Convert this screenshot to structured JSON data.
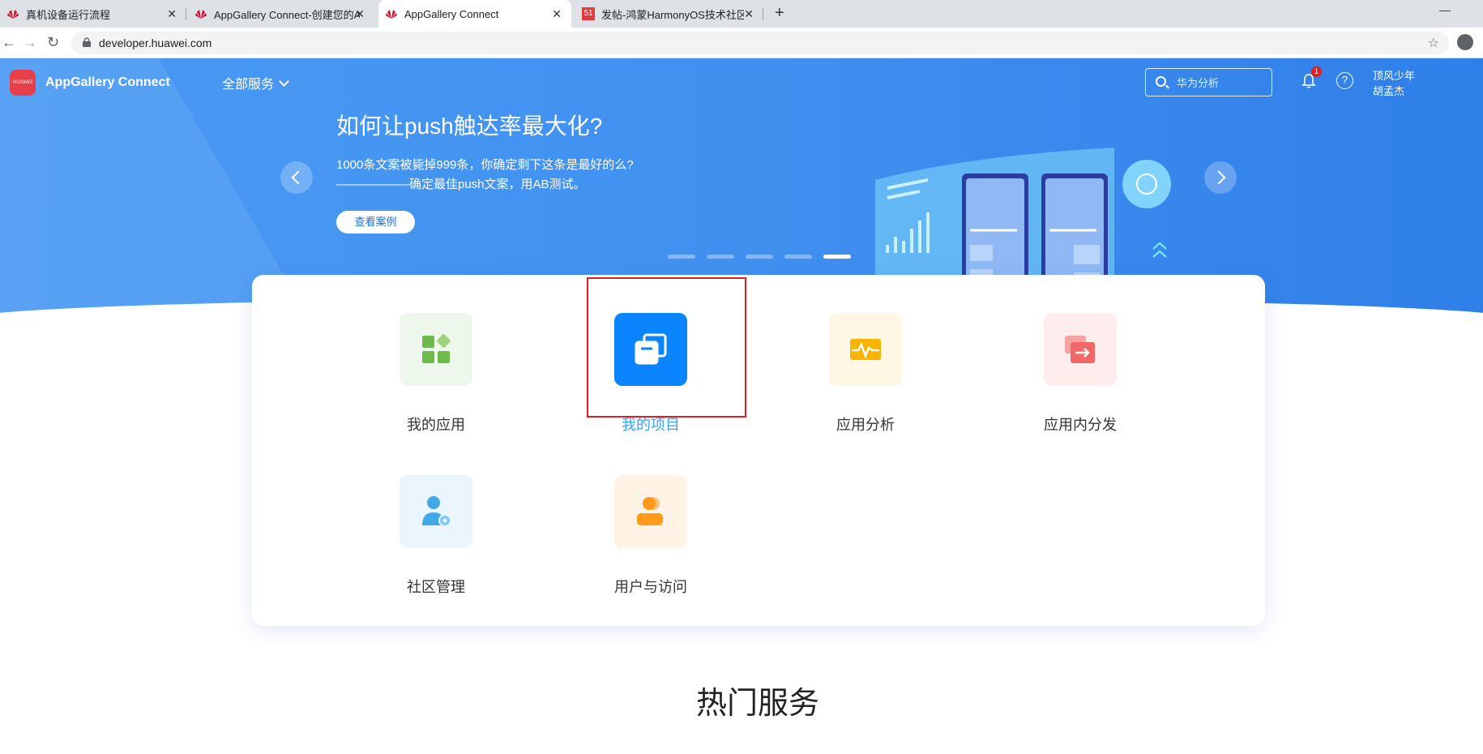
{
  "browser": {
    "tabs": [
      {
        "title": "真机设备运行流程",
        "active": false
      },
      {
        "title": "AppGallery Connect-创建您的A",
        "active": false
      },
      {
        "title": "AppGallery Connect",
        "active": true
      },
      {
        "title": "发帖-鸿蒙HarmonyOS技术社区",
        "active": false
      }
    ],
    "url": "developer.huawei.com"
  },
  "header": {
    "brand": "AppGallery Connect",
    "logo_text": "HUAWEI",
    "all_services": "全部服务",
    "search_placeholder": "华为分析",
    "notification_count": "1",
    "help": "?",
    "user_line1": "顶风少年",
    "user_line2": "胡孟杰"
  },
  "banner": {
    "title": "如何让push触达率最大化?",
    "desc_line1": "1000条文案被毙掉999条，你确定剩下这条是最好的么?",
    "desc_line2": "——————确定最佳push文案，用AB测试。",
    "button": "查看案例",
    "slides": 5,
    "active_slide": 5
  },
  "services": [
    {
      "label": "我的应用",
      "icon": "grid-apps-icon",
      "bg": "#eef7ec",
      "fg": "#6dbb4a"
    },
    {
      "label": "我的项目",
      "icon": "project-stack-icon",
      "bg": "#0a84ff",
      "fg": "#ffffff",
      "selected": true
    },
    {
      "label": "应用分析",
      "icon": "analytics-pulse-icon",
      "bg": "#fff6e3",
      "fg": "#f8b400"
    },
    {
      "label": "应用内分发",
      "icon": "distribute-arrow-icon",
      "bg": "#ffecec",
      "fg": "#f26767"
    },
    {
      "label": "社区管理",
      "icon": "community-user-gear-icon",
      "bg": "#eaf5fd",
      "fg": "#42a9e8"
    },
    {
      "label": "用户与访问",
      "icon": "user-access-icon",
      "bg": "#fff3e6",
      "fg": "#ff9a1a"
    }
  ],
  "section_title": "热门服务"
}
